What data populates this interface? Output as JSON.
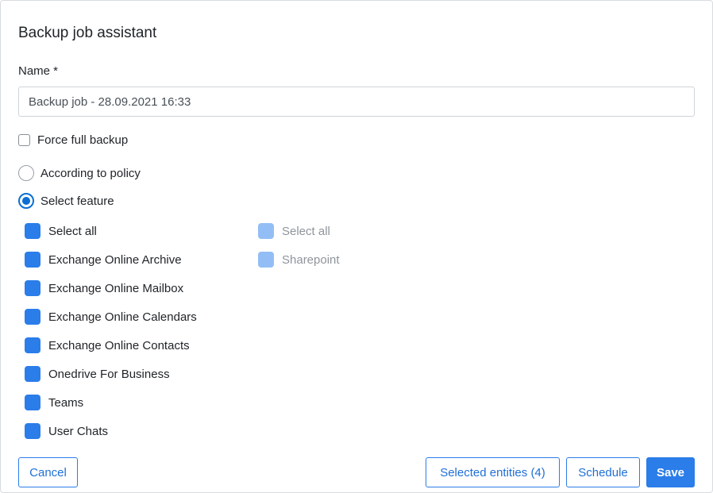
{
  "dialog": {
    "title": "Backup job assistant"
  },
  "name_field": {
    "label": "Name *",
    "value": "Backup job - 28.09.2021 16:33"
  },
  "force_full_backup": {
    "label": "Force full backup",
    "checked": false
  },
  "mode": {
    "options": [
      {
        "label": "According to policy",
        "selected": false
      },
      {
        "label": "Select feature",
        "selected": true
      }
    ]
  },
  "features_left": [
    {
      "label": "Select all",
      "checked": true
    },
    {
      "label": "Exchange Online Archive",
      "checked": true
    },
    {
      "label": "Exchange Online Mailbox",
      "checked": true
    },
    {
      "label": "Exchange Online Calendars",
      "checked": true
    },
    {
      "label": "Exchange Online Contacts",
      "checked": true
    },
    {
      "label": "Onedrive For Business",
      "checked": true
    },
    {
      "label": "Teams",
      "checked": true
    },
    {
      "label": "User Chats",
      "checked": true
    }
  ],
  "features_right": [
    {
      "label": "Select all",
      "checked": true,
      "disabled": true
    },
    {
      "label": "Sharepoint",
      "checked": true,
      "disabled": true
    }
  ],
  "buttons": {
    "cancel": "Cancel",
    "selected_entities": "Selected entities (4)",
    "schedule": "Schedule",
    "save": "Save"
  },
  "colors": {
    "accent": "#2b7de9",
    "accent_disabled": "#93bef5",
    "radio_selected": "#0b6fd3"
  }
}
